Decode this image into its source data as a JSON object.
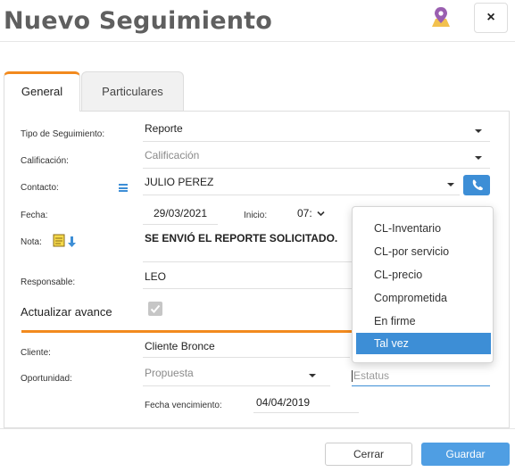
{
  "window": {
    "title": "Nuevo Seguimiento",
    "close_label": "×"
  },
  "tabs": [
    {
      "label": "General",
      "active": true
    },
    {
      "label": "Particulares",
      "active": false
    }
  ],
  "form": {
    "tipo_label": "Tipo de Seguimiento:",
    "tipo_value": "Reporte",
    "calificacion_label": "Calificación:",
    "calificacion_placeholder": "Calificación",
    "contacto_label": "Contacto:",
    "contacto_value": "JULIO PEREZ",
    "fecha_label": "Fecha:",
    "fecha_value": "29/03/2021",
    "inicio_label": "Inicio:",
    "inicio_value": "07:",
    "nota_label": "Nota:",
    "nota_value": "SE ENVIÓ EL REPORTE SOLICITADO.",
    "responsable_label": "Responsable:",
    "responsable_value": "LEO",
    "actualizar_label": "Actualizar avance",
    "actualizar_checked": true,
    "cliente_label": "Cliente:",
    "cliente_value": "Cliente Bronce",
    "oportunidad_label": "Oportunidad:",
    "oportunidad_placeholder": "Propuesta",
    "estatus_placeholder": "Estatus",
    "vencimiento_label": "Fecha vencimiento:",
    "vencimiento_value": "04/04/2019"
  },
  "estatus_dropdown": {
    "options": [
      "CL-Inventario",
      "CL-por servicio",
      "CL-precio",
      "Comprometida",
      "En firme",
      "Tal vez"
    ],
    "selected": "Tal vez"
  },
  "footer": {
    "cancel_label": "Cerrar",
    "save_label": "Guardar"
  },
  "colors": {
    "accent": "#f28a1e",
    "primary": "#3d8ed6",
    "button": "#4f9ee3"
  },
  "icons": {
    "map": "map-pin-icon",
    "phone": "phone-icon",
    "menu": "list-icon",
    "note": "note-icon"
  }
}
